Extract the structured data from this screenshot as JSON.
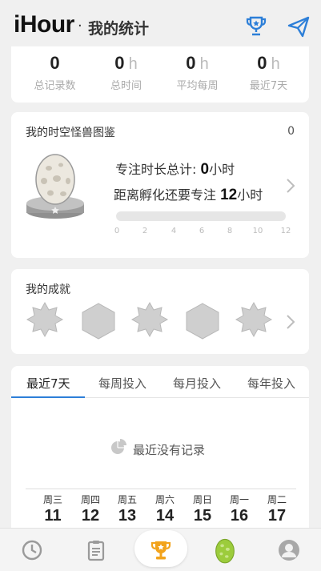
{
  "header": {
    "brand": "iHour",
    "separator": "·",
    "title": "我的统计"
  },
  "stats": [
    {
      "value": "0",
      "unit": "",
      "label": "总记录数"
    },
    {
      "value": "0",
      "unit": "h",
      "label": "总时间"
    },
    {
      "value": "0",
      "unit": "h",
      "label": "平均每周"
    },
    {
      "value": "0",
      "unit": "h",
      "label": "最近7天"
    }
  ],
  "monster": {
    "title": "我的时空怪兽图鉴",
    "count": "0",
    "total_prefix": "专注时长总计: ",
    "total_value": "0",
    "total_unit": "小时",
    "hatch_prefix": "距离孵化还要专注 ",
    "hatch_value": "12",
    "hatch_unit": "小时",
    "progress": 0,
    "ticks": [
      "0",
      "2",
      "4",
      "6",
      "8",
      "10",
      "12"
    ]
  },
  "achievements": {
    "title": "我的成就"
  },
  "trend": {
    "tabs": [
      "最近7天",
      "每周投入",
      "每月投入",
      "每年投入"
    ],
    "active_tab": 0,
    "empty_text": "最近没有记录",
    "days": [
      {
        "name": "周三",
        "num": "11"
      },
      {
        "name": "周四",
        "num": "12"
      },
      {
        "name": "周五",
        "num": "13"
      },
      {
        "name": "周六",
        "num": "14"
      },
      {
        "name": "周日",
        "num": "15"
      },
      {
        "name": "周一",
        "num": "16"
      },
      {
        "name": "周二",
        "num": "17"
      }
    ]
  },
  "colors": {
    "accent": "#2d7fd8",
    "trophy": "#f2a31c",
    "egg": "#9ccc3c",
    "background": "#f0f0f0"
  },
  "icons": [
    "trophy-icon",
    "send-icon",
    "clock-icon",
    "clipboard-icon",
    "egg-icon",
    "user-icon"
  ]
}
